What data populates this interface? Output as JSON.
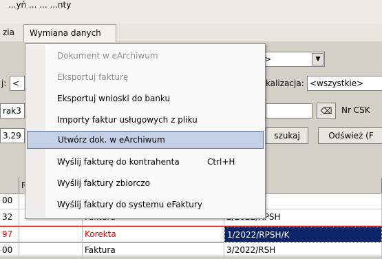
{
  "top_text": "...yń ... ... ...nty",
  "menubar": {
    "left_item": "zia",
    "open_menu": "Wymiana danych"
  },
  "filters": {
    "row1_combo_tail": ">",
    "row1_left_label": "j:",
    "row1_left_value": "<",
    "lokalizacja_label": "kalizacja:",
    "lokalizacja_value": "<wszystkie>",
    "row2_left_value": "rak3",
    "nr_label": "Nr CSK",
    "row3_left_value": "3.29",
    "szukaj_label": "szukaj",
    "refresh_label": "Odśwież (F"
  },
  "grid": {
    "headers": [
      "",
      "R",
      "",
      "aktury"
    ],
    "rows": [
      {
        "c0": "00",
        "c1": "",
        "c2": "",
        "c3": "/RPSH",
        "style": "normal"
      },
      {
        "c0": "32",
        "c1": "",
        "c2": "Faktura",
        "c3": "2/2022/RPSH",
        "style": "normal"
      },
      {
        "c0": "97",
        "c1": "",
        "c2": "Korekta",
        "c3": "1/2022/RPSH/K",
        "style": "red"
      },
      {
        "c0": "00",
        "c1": "",
        "c2": "Faktura",
        "c3": "3/2022/RSH",
        "style": "normal"
      }
    ]
  },
  "dropdown": {
    "items": [
      {
        "label": "Dokument w eArchiwum",
        "disabled": true
      },
      {
        "label": "Eksportuj fakturę",
        "disabled": true
      },
      {
        "label": "Eksportuj wnioski do banku",
        "disabled": false
      },
      {
        "label": "Importy faktur usługowych z pliku",
        "disabled": false
      },
      {
        "label": "Utwórz dok. w eArchiwum",
        "disabled": false,
        "highlighted": true
      },
      {
        "label": "Wyślij fakturę do kontrahenta",
        "shortcut": "Ctrl+H",
        "disabled": false
      },
      {
        "label": "Wyślij faktury zbiorczo",
        "disabled": false
      },
      {
        "label": "Wyślij faktury do systemu eFaktury",
        "disabled": false
      }
    ]
  },
  "colors": {
    "highlight_bg": "#c4d0e6",
    "selected_cell_bg": "#0a246a",
    "correction_red": "#e00000"
  }
}
